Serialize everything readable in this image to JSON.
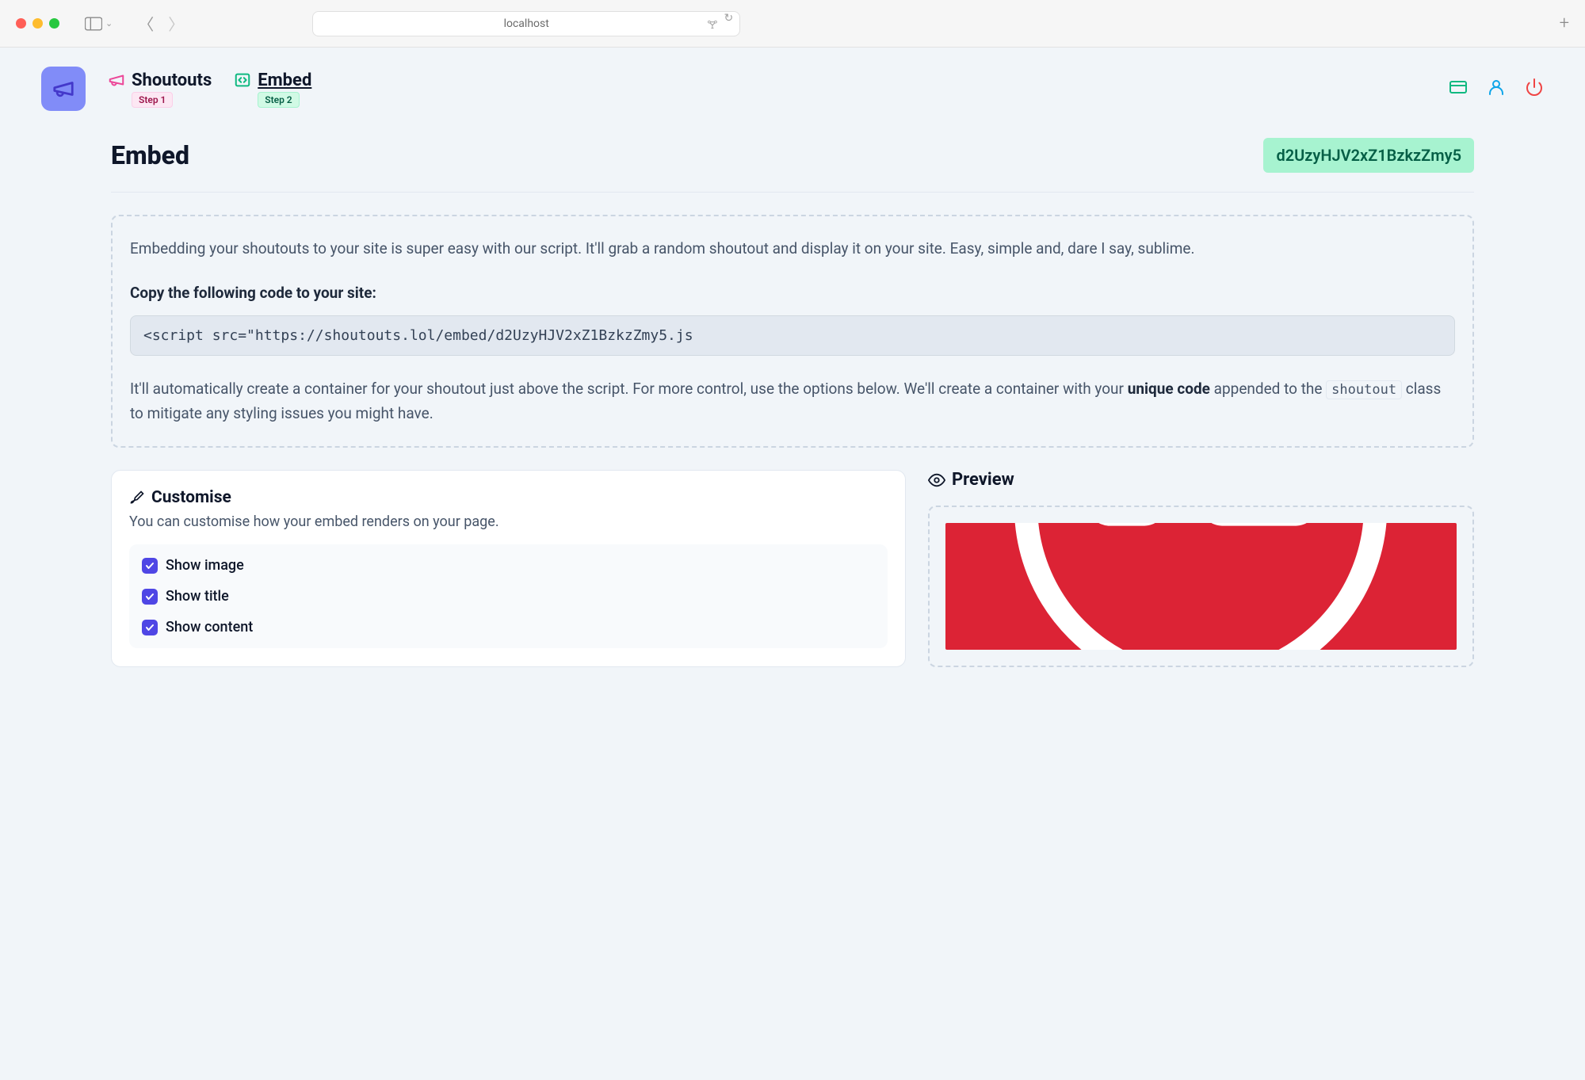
{
  "browser": {
    "url": "localhost"
  },
  "nav": {
    "steps": [
      {
        "label": "Shoutouts",
        "badge": "Step 1"
      },
      {
        "label": "Embed",
        "badge": "Step 2"
      }
    ]
  },
  "page": {
    "title": "Embed",
    "unique_code": "d2UzyHJV2xZ1BzkzZmy5"
  },
  "info": {
    "intro": "Embedding your shoutouts to your site is super easy with our script. It'll grab a random shoutout and display it on your site. Easy, simple and, dare I say, sublime.",
    "heading": "Copy the following code to your site:",
    "code_snippet": "<script src=\"https://shoutouts.lol/embed/d2UzyHJV2xZ1BzkzZmy5.js",
    "post_p1": "It'll automatically create a container for your shoutout just above the script. For more control, use the options below. We'll create a container with your ",
    "post_bold": "unique code",
    "post_p2": " appended to the ",
    "post_code": "shoutout",
    "post_p3": " class to mitigate any styling issues you might have."
  },
  "customise": {
    "title": "Customise",
    "subtitle": "You can customise how your embed renders on your page.",
    "checks": [
      {
        "label": "Show image",
        "checked": true
      },
      {
        "label": "Show title",
        "checked": true
      },
      {
        "label": "Show content",
        "checked": true
      }
    ]
  },
  "preview": {
    "title": "Preview"
  }
}
